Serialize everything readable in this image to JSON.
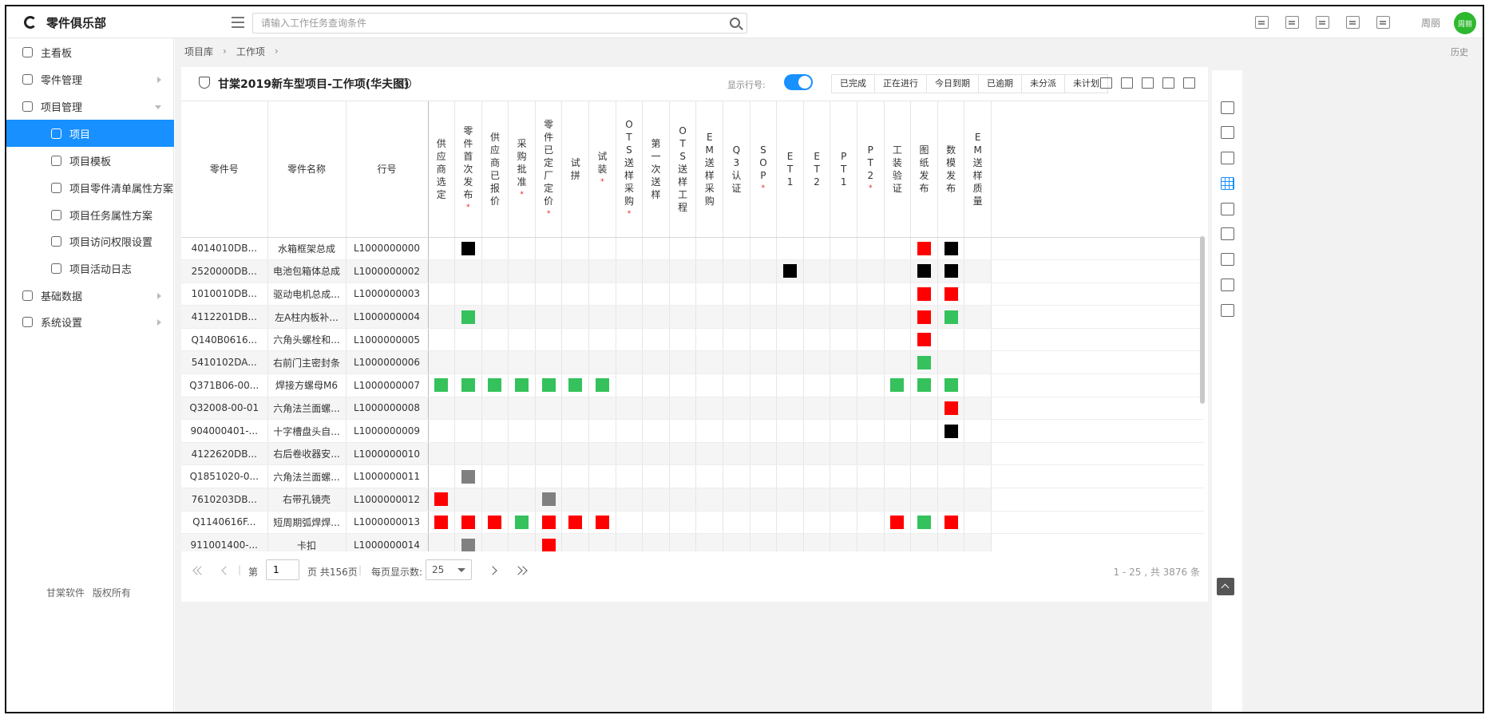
{
  "app": {
    "logo_text": "零件俱乐部",
    "search_placeholder": "请输入工作任务查询条件",
    "user_name": "周丽",
    "avatar_text": "周丽",
    "top_icons": [
      "calendar-check-icon",
      "document-icon",
      "contact-card-icon",
      "swap-icon",
      "chat-icon"
    ]
  },
  "sidebar": {
    "items": [
      {
        "label": "主看板",
        "level": 1,
        "icon": "dashboard-icon"
      },
      {
        "label": "零件管理",
        "level": 1,
        "icon": "user-circle-icon",
        "arrow": "right"
      },
      {
        "label": "项目管理",
        "level": 1,
        "icon": "gear-doc-icon",
        "arrow": "down"
      },
      {
        "label": "项目",
        "level": 2,
        "icon": "gear-icon",
        "active": true
      },
      {
        "label": "项目模板",
        "level": 2,
        "icon": "template-icon"
      },
      {
        "label": "项目零件清单属性方案",
        "level": 2,
        "icon": "list-scheme-icon"
      },
      {
        "label": "项目任务属性方案",
        "level": 2,
        "icon": "task-scheme-icon"
      },
      {
        "label": "项目访问权限设置",
        "level": 2,
        "icon": "shield-icon"
      },
      {
        "label": "项目活动日志",
        "level": 2,
        "icon": "log-icon"
      },
      {
        "label": "基础数据",
        "level": 1,
        "icon": "pie-icon",
        "arrow": "right"
      },
      {
        "label": "系统设置",
        "level": 1,
        "icon": "share-icon",
        "arrow": "right"
      }
    ],
    "footer": "甘棠软件 版权所有"
  },
  "breadcrumb": [
    "项目库",
    "工作项"
  ],
  "history_label": "历史",
  "panel": {
    "title": "甘棠2019新车型项目-工作项(华夫图)",
    "help": "?",
    "toggle_label": "显示行号:",
    "toggle_on": true,
    "filters": [
      "已完成",
      "正在进行",
      "今日到期",
      "已逾期",
      "未分派",
      "未计划"
    ]
  },
  "table": {
    "fixed_headers": [
      "零件号",
      "零件名称",
      "行号"
    ],
    "task_headers": [
      {
        "label": "供应商选定",
        "required": false
      },
      {
        "label": "零件首次发布",
        "required": true
      },
      {
        "label": "供应商已报价",
        "required": false
      },
      {
        "label": "采购批准",
        "required": true
      },
      {
        "label": "零件已定厂定价",
        "required": true
      },
      {
        "label": "试拼",
        "required": false
      },
      {
        "label": "试装",
        "required": true
      },
      {
        "label": "OTS送样采购",
        "required": true
      },
      {
        "label": "第一次送样",
        "required": false
      },
      {
        "label": "OTS送样工程",
        "required": false
      },
      {
        "label": "EM送样采购",
        "required": false
      },
      {
        "label": "Q3认证",
        "required": false
      },
      {
        "label": "SOP",
        "required": true
      },
      {
        "label": "ET1",
        "required": false
      },
      {
        "label": "ET2",
        "required": false
      },
      {
        "label": "PT1",
        "required": false
      },
      {
        "label": "PT2",
        "required": true
      },
      {
        "label": "工装验证",
        "required": false
      },
      {
        "label": "图纸发布",
        "required": false
      },
      {
        "label": "数模发布",
        "required": false
      },
      {
        "label": "EM送样质量",
        "required": false
      }
    ],
    "status_colors": {
      "done": "#35c25c",
      "overdue": "#ff0000",
      "unassigned": "#000000",
      "unplanned": "#808080"
    },
    "rows": [
      {
        "part_no": "4014010DB...",
        "name": "水箱框架总成",
        "line": "L1000000000",
        "marks": {
          "1": "unassigned",
          "18": "overdue",
          "19": "unassigned"
        }
      },
      {
        "part_no": "2520000DB...",
        "name": "电池包箱体总成",
        "line": "L1000000002",
        "marks": {
          "13": "unassigned",
          "18": "unassigned",
          "19": "unassigned"
        }
      },
      {
        "part_no": "1010010DB...",
        "name": "驱动电机总成...",
        "line": "L1000000003",
        "marks": {
          "18": "overdue",
          "19": "overdue"
        }
      },
      {
        "part_no": "4112201DB...",
        "name": "左A柱内板补...",
        "line": "L1000000004",
        "marks": {
          "1": "done",
          "18": "overdue",
          "19": "done"
        }
      },
      {
        "part_no": "Q140B0616...",
        "name": "六角头螺栓和...",
        "line": "L1000000005",
        "marks": {
          "18": "overdue"
        }
      },
      {
        "part_no": "5410102DA...",
        "name": "右前门主密封条",
        "line": "L1000000006",
        "marks": {
          "18": "done"
        }
      },
      {
        "part_no": "Q371B06-00...",
        "name": "焊接方螺母M6",
        "line": "L1000000007",
        "marks": {
          "0": "done",
          "1": "done",
          "2": "done",
          "3": "done",
          "4": "done",
          "5": "done",
          "6": "done",
          "17": "done",
          "18": "done",
          "19": "done"
        }
      },
      {
        "part_no": "Q32008-00-01",
        "name": "六角法兰面螺...",
        "line": "L1000000008",
        "marks": {
          "19": "overdue"
        }
      },
      {
        "part_no": "904000401-...",
        "name": "十字槽盘头自...",
        "line": "L1000000009",
        "marks": {
          "19": "unassigned"
        }
      },
      {
        "part_no": "4122620DB...",
        "name": "右后卷收器安...",
        "line": "L1000000010",
        "marks": {}
      },
      {
        "part_no": "Q1851020-0...",
        "name": "六角法兰面螺...",
        "line": "L1000000011",
        "marks": {
          "1": "unplanned"
        }
      },
      {
        "part_no": "7610203DB...",
        "name": "右带孔镜壳",
        "line": "L1000000012",
        "marks": {
          "0": "overdue",
          "4": "unplanned"
        }
      },
      {
        "part_no": "Q1140616F...",
        "name": "短周期弧焊焊...",
        "line": "L1000000013",
        "marks": {
          "0": "overdue",
          "1": "overdue",
          "2": "overdue",
          "3": "done",
          "4": "overdue",
          "5": "overdue",
          "6": "overdue",
          "17": "overdue",
          "18": "done",
          "19": "overdue"
        }
      },
      {
        "part_no": "911001400-...",
        "name": "卡扣",
        "line": "L1000000014",
        "marks": {
          "1": "unplanned",
          "4": "overdue"
        }
      }
    ]
  },
  "pagination": {
    "page_prefix": "第",
    "page_value": "1",
    "page_suffix": "页 共156页",
    "page_size_label": "每页显示数:",
    "page_size": "25",
    "range_text": "1 - 25 , 共 3876 条"
  },
  "right_toolbar": [
    "form-icon",
    "settings-list-icon",
    "checklist-icon",
    "waffle-grid-icon",
    "user-list-icon",
    "flag-icon",
    "cube-icon",
    "mug-icon",
    "calendar-clock-icon"
  ]
}
